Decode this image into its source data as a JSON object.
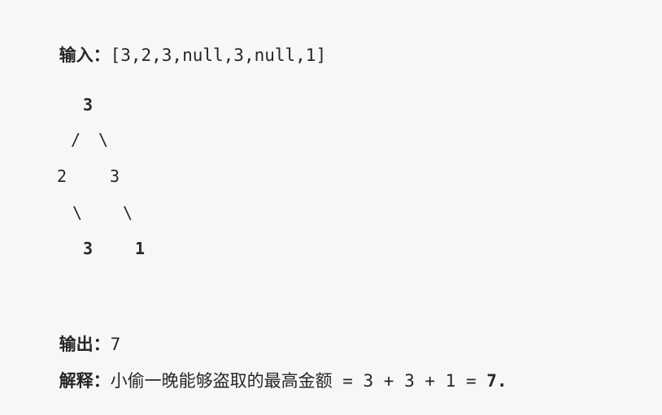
{
  "input": {
    "label": "输入：",
    "value": "[3,2,3,null,3,null,1]"
  },
  "tree": {
    "root": "3",
    "edge_left": "/",
    "edge_right": "\\",
    "left_child": "2",
    "right_child": "3",
    "left_child_edge": "\\",
    "right_child_edge": "\\",
    "left_grandchild": "3",
    "right_grandchild": "1"
  },
  "output": {
    "label": "输出：",
    "value": "7"
  },
  "explanation": {
    "label": "解释：",
    "text": "小偷一晚能够盗取的最高金额",
    "formula": " = 3 + 3 + 1 = ",
    "result": "7."
  }
}
